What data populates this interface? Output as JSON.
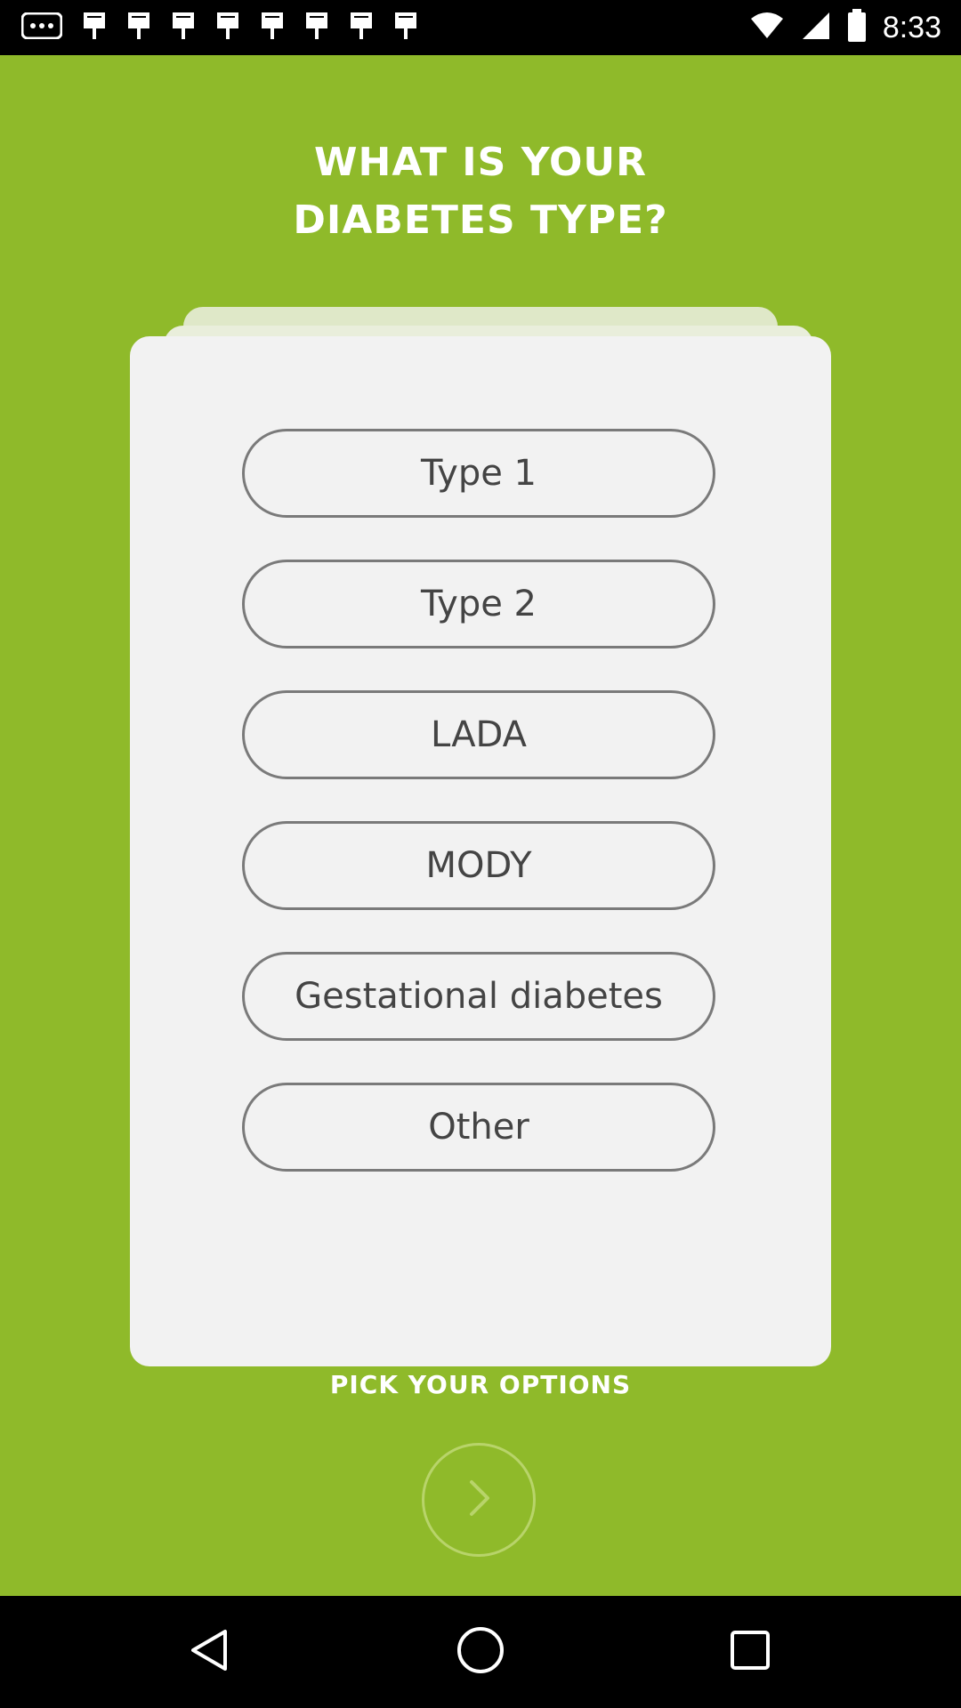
{
  "status_bar": {
    "time": "8:33",
    "icons": [
      "more-notifications-icon",
      "flag-icon",
      "flag-icon",
      "flag-icon",
      "flag-icon",
      "flag-icon",
      "flag-icon",
      "flag-icon",
      "flag-icon",
      "wifi-icon",
      "signal-icon",
      "battery-icon"
    ]
  },
  "header": {
    "title_line1": "WHAT IS YOUR",
    "title_line2": "DIABETES TYPE?"
  },
  "options": [
    {
      "label": "Type 1"
    },
    {
      "label": "Type 2"
    },
    {
      "label": "LADA"
    },
    {
      "label": "MODY"
    },
    {
      "label": "Gestational diabetes"
    },
    {
      "label": "Other"
    }
  ],
  "footer": {
    "hint": "PICK YOUR OPTIONS",
    "next_icon": "chevron-right-icon"
  },
  "nav_bar": {
    "icons": [
      "back-icon",
      "home-icon",
      "recents-icon"
    ]
  },
  "colors": {
    "background": "#8fba2a",
    "card": "#f2f2f2",
    "option_border": "#7a7a7a",
    "text_dark": "#444444",
    "next_button_outline": "#b8d46a"
  }
}
